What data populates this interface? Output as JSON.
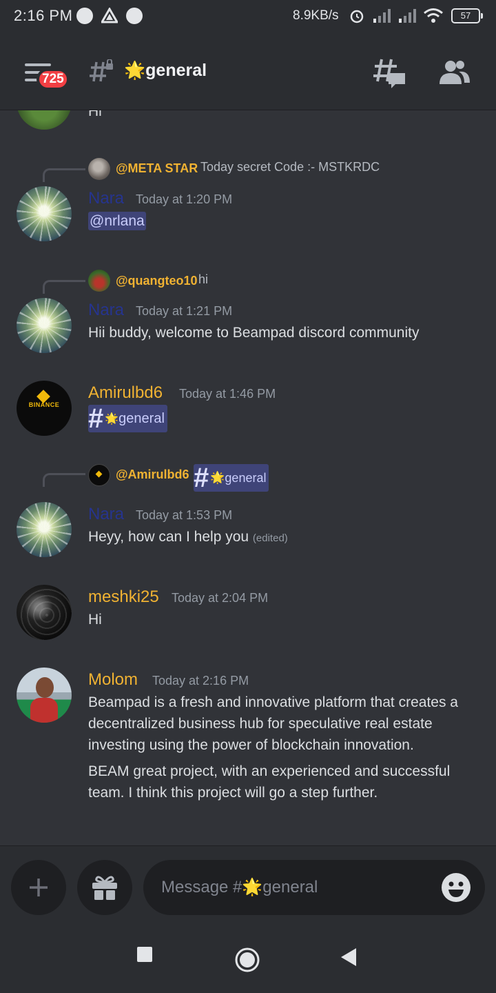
{
  "status_bar": {
    "time": "2:16 PM",
    "net_speed": "8.9KB/s",
    "battery": "57",
    "icons": [
      "telegram-icon",
      "triangle-app-icon",
      "telegram-icon",
      "alarm-icon",
      "signal-icon",
      "signal-icon",
      "wifi-icon",
      "battery-icon"
    ]
  },
  "header": {
    "unread_count": "725",
    "channel_name": "general",
    "channel_emoji": "🌟"
  },
  "messages": [
    {
      "id": "top-partial",
      "body": "Hi"
    },
    {
      "id": "nara-1",
      "reply": {
        "mention": "@META STAR",
        "text": "Today secret Code :- MSTKRDC"
      },
      "username": "Nara",
      "timestamp": "Today at 1:20 PM",
      "body": "@nrlana"
    },
    {
      "id": "nara-2",
      "reply": {
        "mention": "@quangteo10",
        "text": "hi"
      },
      "username": "Nara",
      "timestamp": "Today at 1:21 PM",
      "body": "Hii buddy, welcome to Beampad discord community"
    },
    {
      "id": "amirul",
      "username": "Amirulbd6",
      "timestamp": "Today at 1:46 PM",
      "channel_link": "general",
      "avatar_text": "BINANCE"
    },
    {
      "id": "nara-3",
      "reply": {
        "mention": "@Amirulbd6",
        "channel_link": "general"
      },
      "username": "Nara",
      "timestamp": "Today at 1:53 PM",
      "body": "Heyy, how can I help you",
      "edited": "(edited)"
    },
    {
      "id": "meshki",
      "username": "meshki25",
      "timestamp": "Today at 2:04 PM",
      "body": "Hi"
    },
    {
      "id": "molom",
      "username": "Molom",
      "timestamp": "Today at 2:16 PM",
      "body_lines": [
        "Beampad is a fresh and innovative platform that creates a",
        "decentralized business hub for speculative real estate",
        "investing using the power of blockchain innovation."
      ],
      "body2_lines": [
        "BEAM great project, with an experienced and successful",
        "team. I think this project will go a step further."
      ]
    }
  ],
  "composer": {
    "placeholder_prefix": "Message #",
    "placeholder_channel": "general"
  },
  "colors": {
    "background": "#313338",
    "mention_gold": "#f0b232",
    "nara_name": "#26348e",
    "badge_red": "#f23f43",
    "mention_pill": "#3f4478"
  }
}
